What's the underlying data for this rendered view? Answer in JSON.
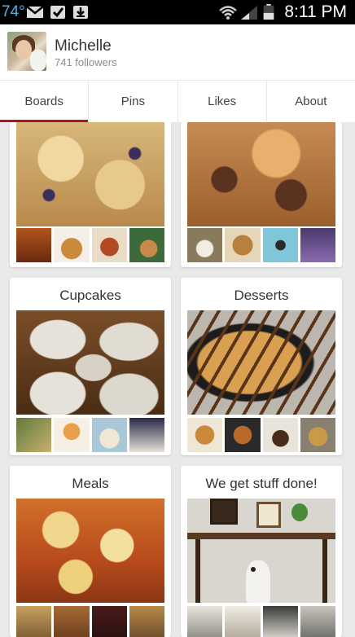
{
  "status_bar": {
    "temperature": "74°",
    "time": "8:11 PM",
    "icons": [
      "gmail-icon",
      "check-icon",
      "download-icon",
      "wifi-icon",
      "signal-icon",
      "battery-icon"
    ]
  },
  "profile": {
    "name": "Michelle",
    "followers": "741 followers"
  },
  "tabs": [
    {
      "label": "Boards",
      "active": true
    },
    {
      "label": "Pins",
      "active": false
    },
    {
      "label": "Likes",
      "active": false
    },
    {
      "label": "About",
      "active": false
    }
  ],
  "accent_color": "#b0141c",
  "boards": [
    {
      "title": ""
    },
    {
      "title": ""
    },
    {
      "title": "Cupcakes"
    },
    {
      "title": "Desserts"
    },
    {
      "title": "Meals"
    },
    {
      "title": "We get stuff done!"
    }
  ]
}
